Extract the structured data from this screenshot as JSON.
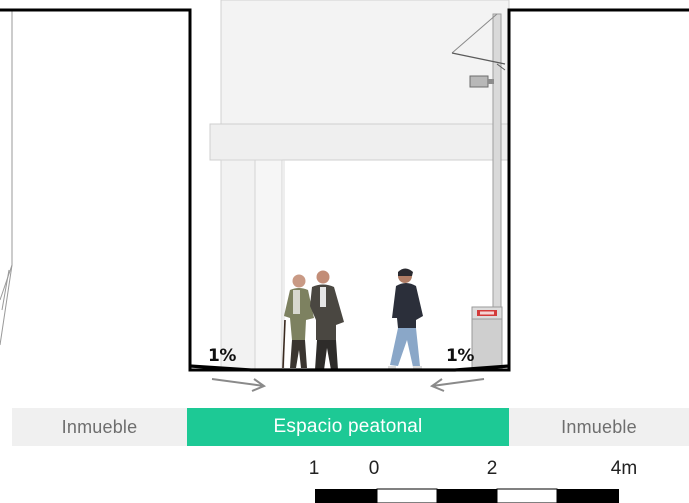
{
  "zones": {
    "left": "Inmueble",
    "center": "Espacio peatonal",
    "right": "Inmueble"
  },
  "slopes": {
    "left": "1%",
    "right": "1%"
  },
  "scale": {
    "labels": [
      "1",
      "0",
      "2",
      "4m"
    ]
  },
  "colors": {
    "pedestrian_zone": "#1dc995",
    "building_zone": "#f0f0f0",
    "outline": "#000000"
  },
  "icons": [
    "pedestrian-figure",
    "street-lamp",
    "security-camera",
    "bollard-planter",
    "drainage-arrow"
  ]
}
